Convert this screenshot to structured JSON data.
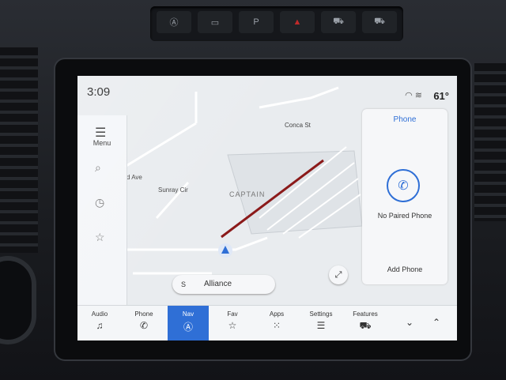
{
  "status": {
    "time": "3:09",
    "temperature": "61°",
    "icons": [
      "wifi-icon",
      "signal-icon"
    ]
  },
  "side_menu": {
    "label": "Menu",
    "icons": [
      "search-icon",
      "clock-icon",
      "star-icon"
    ]
  },
  "map": {
    "streets": [
      "Conca St",
      "d Ave",
      "Sunray Cir"
    ],
    "location_title": "CAPTAIN",
    "route_color": "#8b1a1a"
  },
  "phone_panel": {
    "title": "Phone",
    "status": "No Paired Phone",
    "add_label": "Add Phone",
    "accent": "#2f6fd6"
  },
  "search": {
    "prefix": "S",
    "text": "Alliance"
  },
  "bottom_bar": {
    "items": [
      {
        "label": "Audio",
        "icon": "music-note-icon"
      },
      {
        "label": "Phone",
        "icon": "phone-icon"
      },
      {
        "label": "Nav",
        "icon": "nav-icon",
        "active": true
      },
      {
        "label": "Fav",
        "icon": "star-icon"
      },
      {
        "label": "Apps",
        "icon": "grid-icon"
      },
      {
        "label": "Settings",
        "icon": "settings-icon"
      },
      {
        "label": "Features",
        "icon": "car-icon"
      }
    ]
  },
  "hardware_buttons": [
    {
      "label": "Ⓐ"
    },
    {
      "label": "▭"
    },
    {
      "label": "P"
    },
    {
      "label": "▲"
    },
    {
      "label": "⛟"
    },
    {
      "label": "⛟"
    }
  ]
}
